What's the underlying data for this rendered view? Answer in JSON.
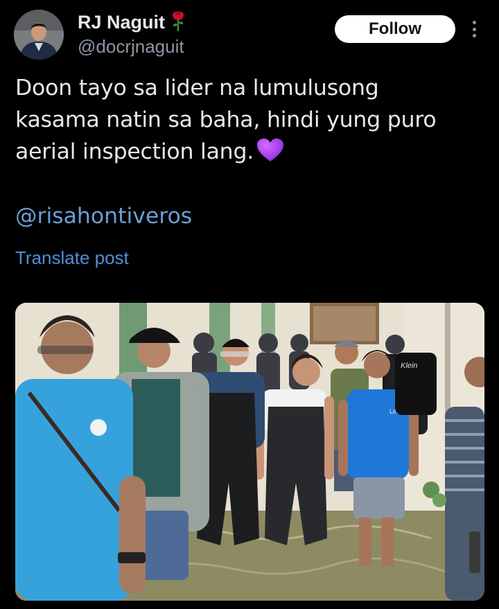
{
  "author": {
    "display_name": "RJ Naguit",
    "badge_icon": "rose-emoji",
    "handle": "@docrjnaguit"
  },
  "actions": {
    "follow_label": "Follow",
    "more_icon": "more-vertical-icon"
  },
  "post": {
    "text": "Doon tayo sa lider na lumulusong\nkasama natin sa baha, hindi yung puro\naerial inspection lang.",
    "emoji": "purple-heart",
    "mention": "@risahontiveros",
    "translate_label": "Translate post"
  },
  "media": {
    "shirt_text_1": "Klein",
    "shirt_text_2": "Life"
  },
  "colors": {
    "background": "#000000",
    "text": "#e7e9ea",
    "secondary": "#8b98a5",
    "link": "#6a9fd6",
    "follow_bg": "#ffffff"
  }
}
